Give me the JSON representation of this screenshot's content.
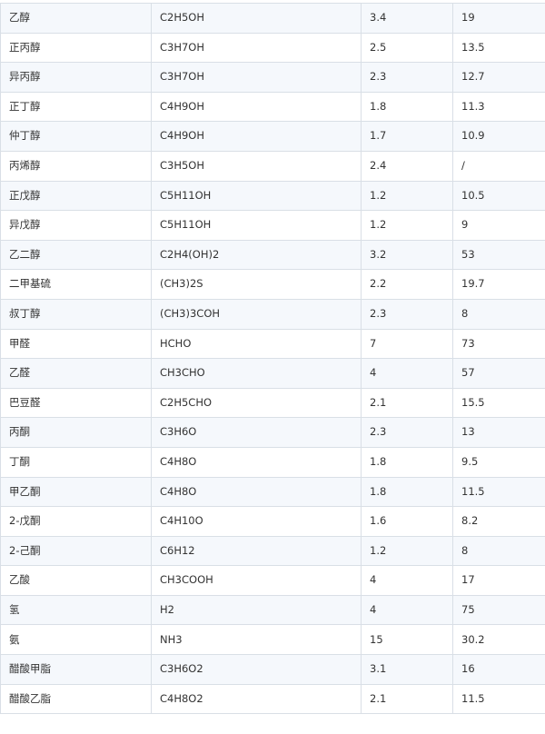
{
  "table": {
    "rows": [
      [
        "乙醇",
        "C2H5OH",
        "3.4",
        "19"
      ],
      [
        "正丙醇",
        "C3H7OH",
        "2.5",
        "13.5"
      ],
      [
        "异丙醇",
        "C3H7OH",
        "2.3",
        "12.7"
      ],
      [
        "正丁醇",
        "C4H9OH",
        "1.8",
        "11.3"
      ],
      [
        "仲丁醇",
        "C4H9OH",
        "1.7",
        "10.9"
      ],
      [
        "丙烯醇",
        "C3H5OH",
        "2.4",
        "/"
      ],
      [
        "正戊醇",
        "C5H11OH",
        "1.2",
        "10.5"
      ],
      [
        "异戊醇",
        "C5H11OH",
        "1.2",
        "9"
      ],
      [
        "乙二醇",
        "C2H4(OH)2",
        "3.2",
        "53"
      ],
      [
        "二甲基硫",
        "(CH3)2S",
        "2.2",
        "19.7"
      ],
      [
        "叔丁醇",
        "(CH3)3COH",
        "2.3",
        "8"
      ],
      [
        "甲醛",
        "HCHO",
        "7",
        "73"
      ],
      [
        "乙醛",
        "CH3CHO",
        "4",
        "57"
      ],
      [
        "巴豆醛",
        "C2H5CHO",
        "2.1",
        "15.5"
      ],
      [
        "丙酮",
        "C3H6O",
        "2.3",
        "13"
      ],
      [
        "丁酮",
        "C4H8O",
        "1.8",
        "9.5"
      ],
      [
        "甲乙酮",
        "C4H8O",
        "1.8",
        "11.5"
      ],
      [
        "2-戊酮",
        "C4H10O",
        "1.6",
        "8.2"
      ],
      [
        "2-己酮",
        "C6H12",
        "1.2",
        "8"
      ],
      [
        "乙酸",
        "CH3COOH",
        "4",
        "17"
      ],
      [
        "氢",
        "H2",
        "4",
        "75"
      ],
      [
        "氨",
        "NH3",
        "15",
        "30.2"
      ],
      [
        "醋酸甲脂",
        "C3H6O2",
        "3.1",
        "16"
      ],
      [
        "醋酸乙脂",
        "C4H8O2",
        "2.1",
        "11.5"
      ]
    ]
  }
}
